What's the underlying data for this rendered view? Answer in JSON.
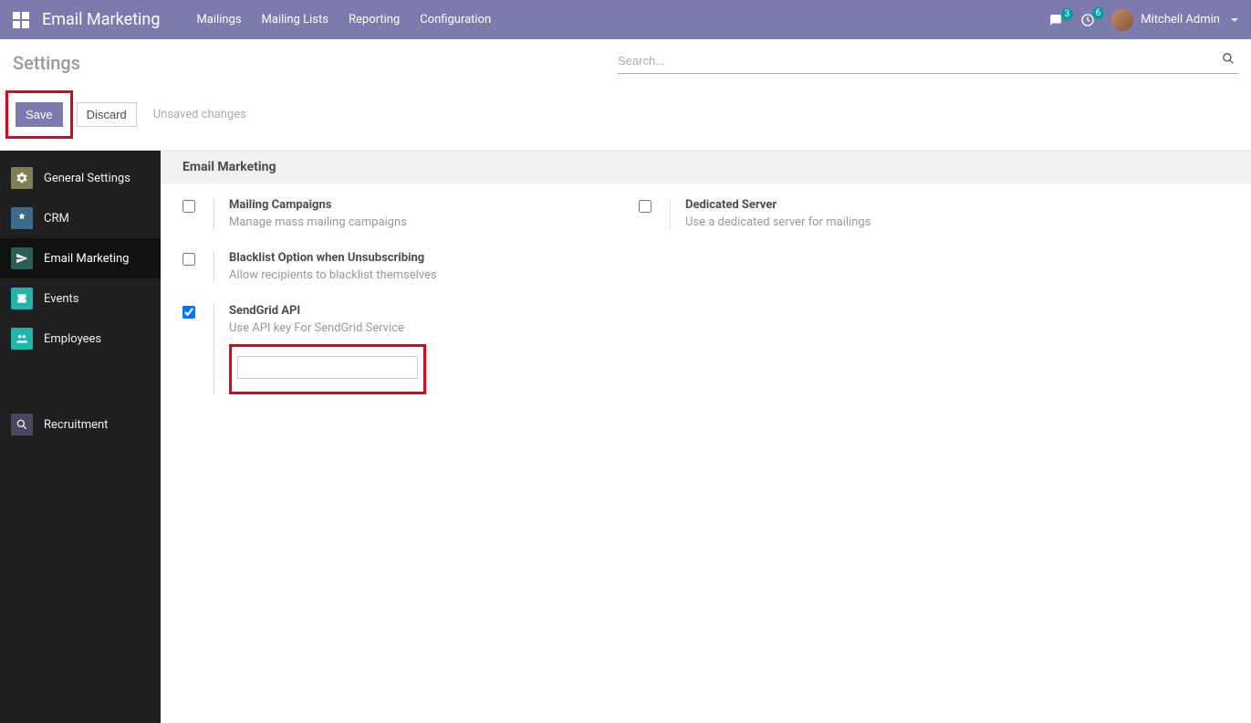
{
  "topnav": {
    "brand": "Email Marketing",
    "menu": [
      "Mailings",
      "Mailing Lists",
      "Reporting",
      "Configuration"
    ],
    "messages_count": "3",
    "activities_count": "6",
    "user_name": "Mitchell Admin"
  },
  "control": {
    "title": "Settings",
    "search_placeholder": "Search...",
    "save_label": "Save",
    "discard_label": "Discard",
    "status": "Unsaved changes"
  },
  "sidebar": {
    "items": [
      {
        "label": "General Settings"
      },
      {
        "label": "CRM"
      },
      {
        "label": "Email Marketing"
      },
      {
        "label": "Events"
      },
      {
        "label": "Employees"
      },
      {
        "label": "Recruitment"
      }
    ]
  },
  "content": {
    "section_title": "Email Marketing",
    "settings": {
      "mailing_campaigns": {
        "label": "Mailing Campaigns",
        "desc": "Manage mass mailing campaigns",
        "checked": false
      },
      "dedicated_server": {
        "label": "Dedicated Server",
        "desc": "Use a dedicated server for mailings",
        "checked": false
      },
      "blacklist": {
        "label": "Blacklist Option when Unsubscribing",
        "desc": "Allow recipients to blacklist themselves",
        "checked": false
      },
      "sendgrid": {
        "label": "SendGrid API",
        "desc": "Use API key For SendGrid Service",
        "checked": true,
        "value": ""
      }
    }
  }
}
